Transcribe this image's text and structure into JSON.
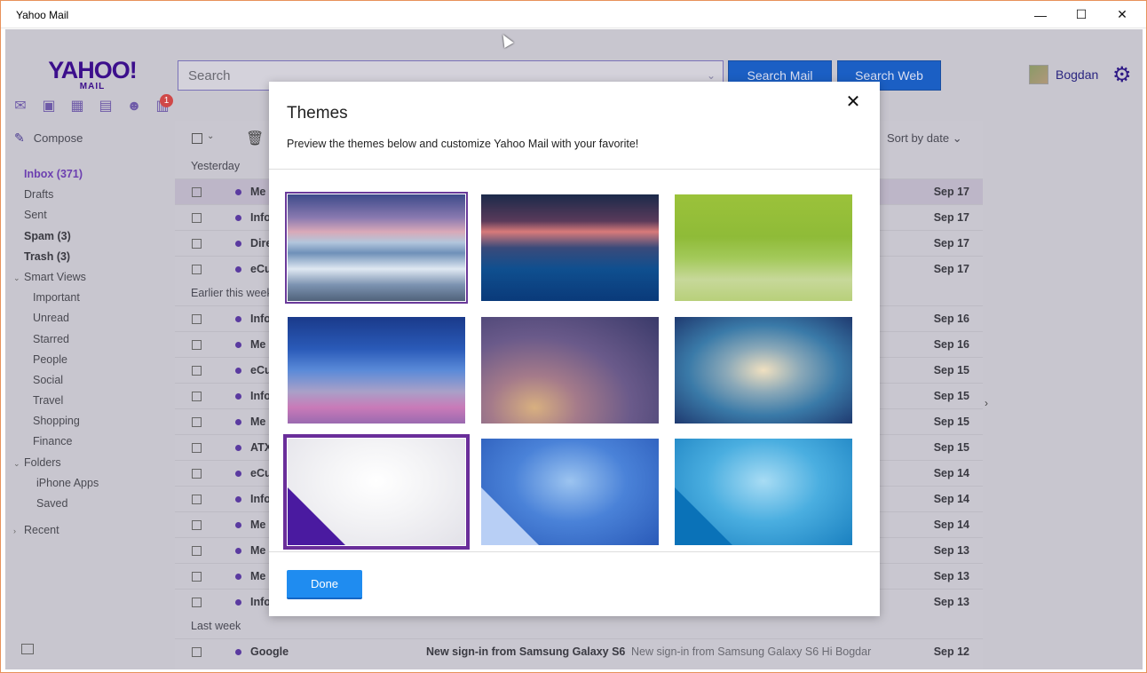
{
  "window": {
    "title": "Yahoo Mail",
    "min_icon": "minimize-icon",
    "max_icon": "maximize-icon",
    "close_icon": "close-icon"
  },
  "header": {
    "logo_main": "YAHOO!",
    "logo_sub": "MAIL",
    "search_placeholder": "Search",
    "search_mail_label": "Search Mail",
    "search_web_label": "Search Web",
    "user_name": "Bogdan",
    "notification_count": "1",
    "accent": "#3c0f8c"
  },
  "sidebar": {
    "compose_label": "Compose",
    "items": [
      {
        "label": "Inbox (371)",
        "style": "active"
      },
      {
        "label": "Drafts",
        "style": ""
      },
      {
        "label": "Sent",
        "style": ""
      },
      {
        "label": "Spam (3)",
        "style": "bold"
      },
      {
        "label": "Trash (3)",
        "style": "bold"
      },
      {
        "label": "Smart Views",
        "style": "caret"
      },
      {
        "label": "Important",
        "style": "sub"
      },
      {
        "label": "Unread",
        "style": "sub"
      },
      {
        "label": "Starred",
        "style": "sub"
      },
      {
        "label": "People",
        "style": "sub"
      },
      {
        "label": "Social",
        "style": "sub"
      },
      {
        "label": "Travel",
        "style": "sub"
      },
      {
        "label": "Shopping",
        "style": "sub"
      },
      {
        "label": "Finance",
        "style": "sub"
      },
      {
        "label": "Folders",
        "style": "caret"
      },
      {
        "label": "iPhone Apps",
        "style": "sub2"
      },
      {
        "label": "Saved",
        "style": "sub2"
      },
      {
        "label": "Recent",
        "style": "caret-right"
      }
    ]
  },
  "list": {
    "sort_label": "Sort by date",
    "groups": [
      {
        "label": "Yesterday",
        "rows": [
          {
            "from": "Me",
            "date": "Sep 17",
            "selected": true
          },
          {
            "from": "Info",
            "date": "Sep 17"
          },
          {
            "from": "Dire",
            "date": "Sep 17"
          },
          {
            "from": "eCu",
            "date": "Sep 17"
          }
        ]
      },
      {
        "label": "Earlier this week",
        "rows": [
          {
            "from": "Info",
            "date": "Sep 16"
          },
          {
            "from": "Me",
            "date": "Sep 16"
          },
          {
            "from": "eCu",
            "date": "Sep 15"
          },
          {
            "from": "Info",
            "date": "Sep 15"
          },
          {
            "from": "Me",
            "date": "Sep 15"
          },
          {
            "from": "ATX",
            "date": "Sep 15"
          },
          {
            "from": "eCu",
            "date": "Sep 14"
          },
          {
            "from": "Info",
            "date": "Sep 14"
          },
          {
            "from": "Me",
            "date": "Sep 14"
          },
          {
            "from": "Me",
            "date": "Sep 13"
          },
          {
            "from": "Me",
            "date": "Sep 13"
          },
          {
            "from": "Info",
            "date": "Sep 13"
          }
        ]
      },
      {
        "label": "Last week",
        "rows": [
          {
            "from": "Google",
            "subject": "New sign-in from Samsung Galaxy S6",
            "preview": "New sign-in from Samsung Galaxy S6 Hi Bogdar",
            "date": "Sep 12"
          }
        ]
      }
    ]
  },
  "modal": {
    "title": "Themes",
    "subtitle": "Preview the themes below and customize Yahoo Mail with your favorite!",
    "done_label": "Done",
    "themes": [
      {
        "name": "theme-ocean-waves"
      },
      {
        "name": "theme-pier-sunset"
      },
      {
        "name": "theme-green-dewdrops"
      },
      {
        "name": "theme-bridge-dusk"
      },
      {
        "name": "theme-blur-purple"
      },
      {
        "name": "theme-blur-teal"
      },
      {
        "name": "theme-purple-corner"
      },
      {
        "name": "theme-blue-corner"
      },
      {
        "name": "theme-cyan-corner"
      }
    ]
  }
}
